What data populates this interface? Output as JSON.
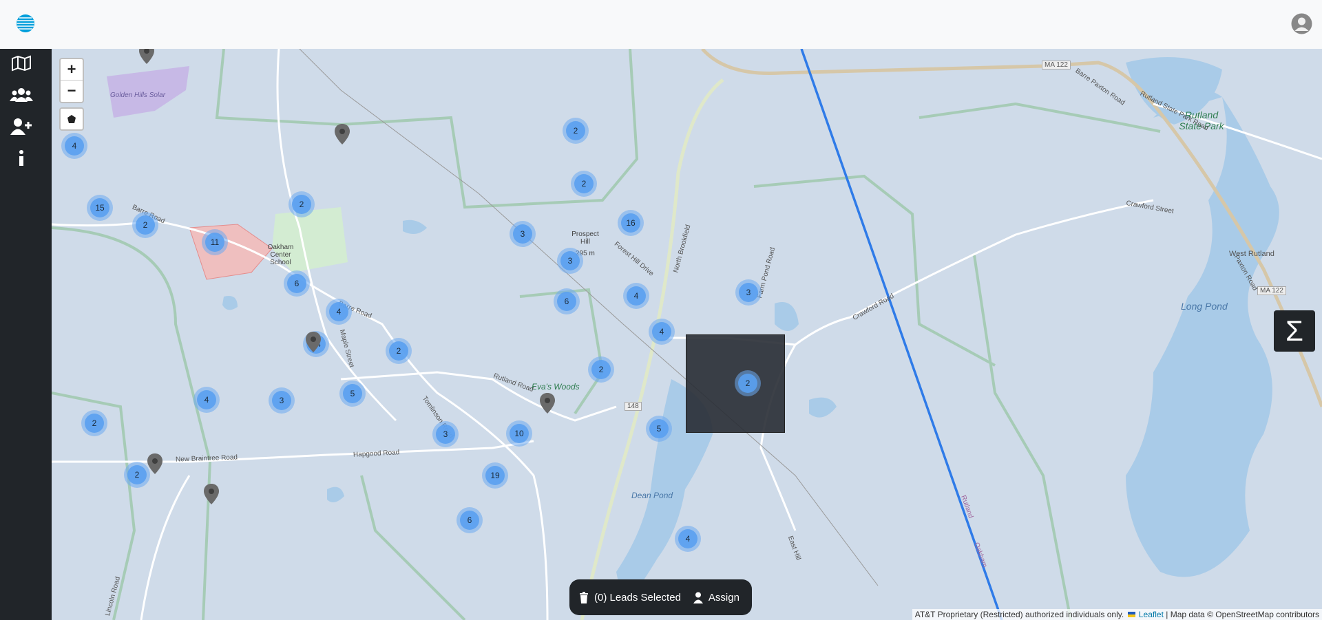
{
  "header": {
    "logo_icon": "att-globe-icon",
    "user_icon": "user-circle-icon"
  },
  "sidebar": {
    "items": [
      {
        "name": "map-icon"
      },
      {
        "name": "users-icon"
      },
      {
        "name": "user-plus-icon"
      },
      {
        "name": "info-icon"
      }
    ]
  },
  "map_controls": {
    "zoom_in": "+",
    "zoom_out": "−",
    "draw_icon": "polygon-icon"
  },
  "labels": {
    "golden_hills": "Golden\nHills Solar",
    "oakham_school": "Oakham Center School",
    "prospect_hill": "Prospect Hill",
    "prospect_elev": "295 m",
    "evas_woods": "Eva's Woods",
    "rutland_sp": "Rutland State Park",
    "long_pond": "Long Pond",
    "dean_pond": "Dean Pond",
    "west_rutland": "West Rutland",
    "ma122_a": "MA 122",
    "ma122_b": "MA 122",
    "r148": "148",
    "barre_road1": "Barre Road",
    "barre_road2": "Barre Road",
    "barre_paxton": "Barre Paxton Road",
    "paxton_road": "Paxton Road",
    "rutland_state_park_road": "Rutland State Park Road",
    "crawford_st": "Crawford Street",
    "crawford_rd": "Crawford Road",
    "rutland_road": "Rutland Road",
    "new_braintree": "New Braintree Road",
    "hapgood": "Hapgood Road",
    "north_brookfield": "North Brookfield",
    "tomlinson": "Tomlinson Road",
    "east_hill": "East Hill",
    "rutland_border": "Rutland",
    "oakham_border": "Oakham",
    "maple": "Maple Street",
    "lincoln": "Lincoln Road",
    "forest_hill": "Forest Hill Drive",
    "farm_pond": "Farm Pond Road"
  },
  "clusters": [
    {
      "count": "4"
    },
    {
      "count": "15"
    },
    {
      "count": "2"
    },
    {
      "count": "11"
    },
    {
      "count": "2"
    },
    {
      "count": "6"
    },
    {
      "count": "4"
    },
    {
      "count": "14"
    },
    {
      "count": "2"
    },
    {
      "count": "5"
    },
    {
      "count": "3"
    },
    {
      "count": "4"
    },
    {
      "count": "2"
    },
    {
      "count": "2"
    },
    {
      "count": "2"
    },
    {
      "count": "2"
    },
    {
      "count": "3"
    },
    {
      "count": "3"
    },
    {
      "count": "6"
    },
    {
      "count": "4"
    },
    {
      "count": "16"
    },
    {
      "count": "3"
    },
    {
      "count": "2"
    },
    {
      "count": "2"
    },
    {
      "count": "5"
    },
    {
      "count": "4"
    },
    {
      "count": "3"
    },
    {
      "count": "10"
    },
    {
      "count": "19"
    },
    {
      "count": "6"
    },
    {
      "count": "4"
    }
  ],
  "sigma_label": "Σ",
  "lead_bar": {
    "selected": "(0) Leads Selected",
    "assign": "Assign",
    "trash_icon": "trash-icon",
    "assign_icon": "user-icon"
  },
  "attribution": {
    "text": "AT&T Proprietary (Restricted) authorized individuals only.",
    "leaflet": "Leaflet",
    "mapdata": "| Map data © OpenStreetMap contributors"
  },
  "colors": {
    "sidebar": "#212529",
    "cluster": "#5aa0f0",
    "line": "#3b82f6"
  }
}
